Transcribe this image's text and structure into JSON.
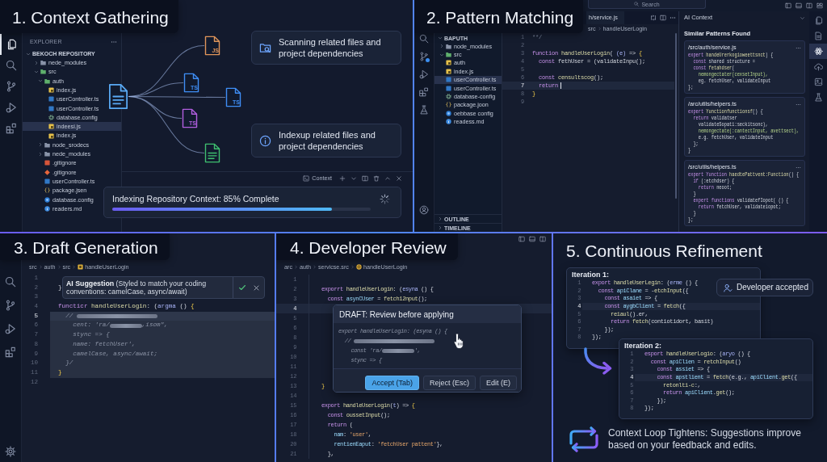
{
  "context_gathering": {
    "title": "1. Context Gathering",
    "activity_bar": [
      {
        "selected": true
      },
      {
        "selected": false
      },
      {
        "selected": false
      },
      {
        "selected": false
      },
      {
        "selected": false
      }
    ],
    "explorer": {
      "header": "EXPLORER",
      "repository": "BEKOCH REPOSITORY",
      "expanded": true,
      "tree": [
        {
          "name": "nede_modules",
          "kind": "folder",
          "expanded": false,
          "selected": false
        },
        {
          "name": "src",
          "kind": "folder",
          "expanded": true,
          "selected": false,
          "children": [
            {
              "name": "auth",
              "kind": "folder",
              "expanded": true,
              "selected": false,
              "children": [
                {
                  "name": "index.js",
                  "kind": "js",
                  "selected": false
                },
                {
                  "name": "userController.ts",
                  "kind": "ts",
                  "selected": false
                },
                {
                  "name": "userController.ts",
                  "kind": "ts",
                  "selected": false
                },
                {
                  "name": "database.config",
                  "kind": "config",
                  "selected": false
                },
                {
                  "name": "indeesi.js",
                  "kind": "js",
                  "selected": true
                },
                {
                  "name": "index.js",
                  "kind": "js",
                  "selected": false
                }
              ]
            },
            {
              "name": "node_srodecs",
              "kind": "folder",
              "expanded": false,
              "selected": false
            },
            {
              "name": "nede_modules",
              "kind": "folder",
              "expanded": false,
              "selected": false
            },
            {
              "name": ".gitignore",
              "kind": "ignore",
              "selected": false
            },
            {
              "name": ".gitignore",
              "kind": "git",
              "selected": false
            },
            {
              "name": "userController.ts",
              "kind": "ts",
              "selected": false
            },
            {
              "name": "package.jsen",
              "kind": "json",
              "selected": false
            },
            {
              "name": "database.config",
              "kind": "db",
              "selected": false
            },
            {
              "name": "readers.md",
              "kind": "markdown",
              "selected": false
            }
          ]
        }
      ]
    },
    "diagram": {
      "nodes": [
        {
          "kind": "doc",
          "color": "#5aaaf5"
        },
        {
          "kind": "code",
          "label": "JS",
          "color": "#e0955a"
        },
        {
          "kind": "code",
          "label": "TS",
          "color": "#3f8ef5"
        },
        {
          "kind": "code",
          "label": "TS",
          "color": "#3f8ef5"
        },
        {
          "kind": "code",
          "label": "TS",
          "color": "#b25fe0"
        },
        {
          "kind": "doc",
          "color": "#3fbf6f"
        }
      ]
    },
    "callouts": [
      {
        "kind": "scan",
        "text": "Scanning related files and project dependencies"
      },
      {
        "kind": "info",
        "text": "Indexup related files and project dependencies"
      }
    ],
    "terminal_tab": {
      "label": "Context"
    },
    "progress": {
      "label": "Indexing Repository Context: 85% Complete",
      "level": 0.85
    }
  },
  "pattern_matching": {
    "title": "2. Pattern Matching",
    "command_center": {
      "label": "Search"
    },
    "sidebar": {
      "header": "BAPUTH",
      "expanded": true,
      "tree": [
        {
          "name": "node_modules",
          "kind": "folder",
          "expanded": false,
          "selected": false
        },
        {
          "name": "src",
          "kind": "folder",
          "expanded": true,
          "selected": false,
          "children": [
            {
              "name": "auth",
              "kind": "js",
              "selected": false
            },
            {
              "name": "index.js",
              "kind": "js",
              "selected": false
            },
            {
              "name": "userController.ts",
              "kind": "ts",
              "selected": true
            },
            {
              "name": "userController.ts",
              "kind": "ts",
              "selected": false
            },
            {
              "name": "database-config",
              "kind": "config",
              "selected": false
            },
            {
              "name": "package.joon",
              "kind": "json",
              "selected": false
            },
            {
              "name": "oebbase config",
              "kind": "db",
              "selected": false
            },
            {
              "name": "readess.md",
              "kind": "markdown",
              "selected": false
            }
          ]
        }
      ],
      "sections": [
        {
          "label": "OUTLINE",
          "expanded": false
        },
        {
          "label": "TIMELINE",
          "expanded": false
        }
      ]
    },
    "tab": {
      "label": "h/service.js"
    },
    "breadcrumb": [
      {
        "label": "src"
      },
      {
        "label": "handleUserLogin"
      }
    ],
    "editor": {
      "cursor": true,
      "lines": [
        {
          "number": "1",
          "active": false,
          "tokens": [
            {
              "kind": "comment",
              "text": "**/"
            }
          ]
        },
        {
          "number": "2",
          "active": false
        },
        {
          "number": "3",
          "active": false,
          "tokens": [
            {
              "kind": "keyword",
              "text": "function"
            },
            {
              "kind": "function",
              "text": " handleUserLogin"
            },
            {
              "kind": "plain",
              "text": "( "
            },
            {
              "kind": "param",
              "text": "(e)"
            },
            {
              "kind": "plain",
              "text": " => "
            },
            {
              "kind": "brace",
              "text": "{"
            }
          ]
        },
        {
          "number": "4",
          "active": false,
          "tokens": [
            {
              "kind": "keyword",
              "text": "  const"
            },
            {
              "kind": "plain",
              "text": " fethUser = (validateInpu();"
            }
          ]
        },
        {
          "number": "5",
          "active": false
        },
        {
          "number": "6",
          "active": false,
          "tokens": [
            {
              "kind": "keyword",
              "text": "  const"
            },
            {
              "kind": "function",
              "text": " censultscog"
            },
            {
              "kind": "plain",
              "text": "();"
            }
          ]
        },
        {
          "number": "7",
          "active": true,
          "tokens": [
            {
              "kind": "keyword",
              "text": "  return"
            }
          ]
        },
        {
          "number": "8",
          "active": false,
          "tokens": [
            {
              "kind": "brace",
              "text": "}"
            }
          ]
        },
        {
          "number": "9",
          "active": false
        }
      ]
    },
    "ai_context": {
      "title": "AI Context",
      "heading": "Similar Patterns Found",
      "cards": [
        {
          "path": "/src/auth/service.js",
          "lines": [
            {
              "tokens": [
                {
                  "kind": "keyword",
                  "text": "expert"
                },
                {
                  "kind": "function",
                  "text": " handeUrerkogioweettsnct"
                },
                {
                  "kind": "plain",
                  "text": ") {"
                }
              ]
            },
            {
              "tokens": [
                {
                  "kind": "keyword",
                  "text": "  const"
                },
                {
                  "kind": "plain",
                  "text": " shared structure ="
                }
              ]
            },
            {
              "tokens": [
                {
                  "kind": "keyword",
                  "text": "  const"
                },
                {
                  "kind": "function",
                  "text": " fetahdser"
                },
                {
                  "kind": "plain",
                  "text": "("
                }
              ]
            },
            {
              "tokens": [
                {
                  "kind": "green",
                  "text": "    nemongectater(cexsetInput),"
                }
              ]
            },
            {
              "tokens": [
                {
                  "kind": "plain",
                  "text": "    eg. fetchUser, validateInput"
                }
              ]
            },
            {
              "tokens": [
                {
                  "kind": "plain",
                  "text": "};"
                }
              ]
            }
          ]
        },
        {
          "path": "/arc/utils/helpers.ts",
          "lines": [
            {
              "tokens": [
                {
                  "kind": "keyword",
                  "text": "expert"
                },
                {
                  "kind": "function",
                  "text": " Yunctionfunctionsf"
                },
                {
                  "kind": "plain",
                  "text": "() {"
                }
              ]
            },
            {
              "tokens": [
                {
                  "kind": "keyword",
                  "text": "  return"
                },
                {
                  "kind": "plain",
                  "text": " validatser"
                }
              ]
            },
            {
              "tokens": [
                {
                  "kind": "plain",
                  "text": "    validateSopati:seckitsonc),"
                }
              ]
            },
            {
              "tokens": [
                {
                  "kind": "green",
                  "text": "    nemongectate(:cantectInput, avettsect),"
                }
              ]
            },
            {
              "tokens": [
                {
                  "kind": "plain",
                  "text": "    e.g. fetchUser, validateInput"
                }
              ]
            },
            {
              "tokens": [
                {
                  "kind": "plain",
                  "text": "  };"
                }
              ]
            },
            {
              "tokens": [
                {
                  "kind": "plain",
                  "text": "}"
                }
              ]
            }
          ]
        },
        {
          "path": "/src/utils/helpers.ts",
          "lines": [
            {
              "tokens": [
                {
                  "kind": "keyword",
                  "text": "expert Yunction"
                },
                {
                  "kind": "function",
                  "text": " haedtePattvent:Function"
                },
                {
                  "kind": "plain",
                  "text": "() {"
                }
              ]
            },
            {
              "tokens": [
                {
                  "kind": "keyword",
                  "text": "  if"
                },
                {
                  "kind": "plain",
                  "text": " (:etchdser) {"
                }
              ]
            },
            {
              "tokens": [
                {
                  "kind": "keyword",
                  "text": "    return"
                },
                {
                  "kind": "plain",
                  "text": " neoot;"
                }
              ]
            },
            {
              "tokens": [
                {
                  "kind": "plain",
                  "text": "  }"
                }
              ]
            },
            {
              "tokens": [
                {
                  "kind": "keyword",
                  "text": "  expert functions"
                },
                {
                  "kind": "plain",
                  "text": " validatefIopot( () {"
                }
              ]
            },
            {
              "tokens": [
                {
                  "kind": "keyword",
                  "text": "    return"
                },
                {
                  "kind": "plain",
                  "text": " fetchUser, validateiopot;"
                }
              ]
            },
            {
              "tokens": [
                {
                  "kind": "plain",
                  "text": "  }"
                }
              ]
            },
            {
              "tokens": [
                {
                  "kind": "plain",
                  "text": "};"
                }
              ]
            }
          ]
        }
      ]
    },
    "right_bar": [
      {
        "selected": false
      },
      {
        "selected": false
      },
      {
        "selected": true
      },
      {
        "selected": false
      },
      {
        "selected": false
      },
      {
        "selected": false
      }
    ]
  },
  "draft_generation": {
    "title": "3. Draft Generation",
    "breadcrumb": [
      {
        "label": "src",
        "kind": "plain"
      },
      {
        "label": "auth",
        "kind": "plain"
      },
      {
        "label": "src",
        "kind": "plain"
      },
      {
        "label": "handleUserLogin",
        "kind": "symbol"
      }
    ],
    "suggestion": {
      "text": "**AI Suggestion** (Styled to match your coding conventions: camelCase, async/await)"
    },
    "editor": {
      "lines": [
        {
          "number": "1",
          "active": false
        },
        {
          "number": "2",
          "active": false,
          "tokens": [
            {
              "kind": "plain",
              "text": "}"
            }
          ]
        },
        {
          "number": "3",
          "active": false
        },
        {
          "number": "4",
          "active": false,
          "tokens": [
            {
              "kind": "keyword",
              "text": "functicr"
            },
            {
              "kind": "function",
              "text": " handleUserLogin"
            },
            {
              "kind": "plain",
              "text": ": ("
            },
            {
              "kind": "param",
              "text": "argma"
            },
            {
              "kind": "plain",
              "text": " () "
            },
            {
              "kind": "brace",
              "text": "{"
            }
          ]
        }
      ],
      "suggestion_block": {
        "lines": [
          {
            "number": "5",
            "active": true,
            "tokens": [
              {
                "kind": "ghost",
                "text": "  // "
              },
              {
                "kind": "blur"
              }
            ]
          },
          {
            "number": "6",
            "active": false,
            "tokens": [
              {
                "kind": "ghost",
                "text": "    cent: 'ra/"
              },
              {
                "kind": "smudge"
              },
              {
                "kind": "ghost",
                "text": ",isom\","
              }
            ]
          },
          {
            "number": "7",
            "active": false,
            "tokens": [
              {
                "kind": "ghost",
                "text": "    stync => {"
              }
            ]
          },
          {
            "number": "8",
            "active": false,
            "tokens": [
              {
                "kind": "ghost",
                "text": "    name: fetchUser',"
              }
            ]
          },
          {
            "number": "9",
            "active": false,
            "tokens": [
              {
                "kind": "ghost",
                "text": "    camelCase, async/await;"
              }
            ]
          },
          {
            "number": "10",
            "active": false,
            "tokens": [
              {
                "kind": "ghost",
                "text": "  }/"
              }
            ]
          },
          {
            "number": "11",
            "active": false,
            "tokens": [
              {
                "kind": "brace",
                "text": "}"
              }
            ]
          }
        ]
      },
      "lines_after": [
        {
          "number": "12",
          "active": false
        }
      ]
    }
  },
  "developer_review": {
    "title": "4. Developer Review",
    "breadcrumb": [
      {
        "label": "arc",
        "kind": "plain"
      },
      {
        "label": "auth",
        "kind": "plain"
      },
      {
        "label": "servicse.src",
        "kind": "plain"
      },
      {
        "label": "handleUserLogin",
        "kind": "method"
      }
    ],
    "editor": {
      "lines": [
        {
          "number": "1",
          "active": false
        },
        {
          "number": "2",
          "active": false,
          "tokens": [
            {
              "kind": "keyword",
              "text": "exporrt"
            },
            {
              "kind": "function",
              "text": " handleUserLogin"
            },
            {
              "kind": "plain",
              "text": ": ("
            },
            {
              "kind": "param",
              "text": "esyna"
            },
            {
              "kind": "plain",
              "text": " () {"
            }
          ]
        },
        {
          "number": "3",
          "active": false,
          "tokens": [
            {
              "kind": "keyword",
              "text": "  const"
            },
            {
              "kind": "variable",
              "text": " asynCUser"
            },
            {
              "kind": "plain",
              "text": " = "
            },
            {
              "kind": "function",
              "text": "fetch12nput"
            },
            {
              "kind": "plain",
              "text": "();"
            }
          ]
        },
        {
          "number": "4",
          "active": true
        },
        {
          "number": "5",
          "active": false
        },
        {
          "number": "6",
          "active": false
        },
        {
          "number": "8",
          "active": false
        },
        {
          "number": "9",
          "active": false
        },
        {
          "number": "10",
          "active": false
        },
        {
          "number": "11",
          "active": false
        },
        {
          "number": "12",
          "active": false
        },
        {
          "number": "13",
          "active": false,
          "tokens": [
            {
              "kind": "brace",
              "text": "}"
            }
          ]
        },
        {
          "number": "14",
          "active": false
        },
        {
          "number": "15",
          "active": false,
          "tokens": [
            {
              "kind": "keyword",
              "text": "export"
            },
            {
              "kind": "function",
              "text": " handleUserLogin"
            },
            {
              "kind": "plain",
              "text": "("
            },
            {
              "kind": "param",
              "text": "t"
            },
            {
              "kind": "plain",
              "text": ") => "
            },
            {
              "kind": "brace",
              "text": "{"
            }
          ]
        },
        {
          "number": "16",
          "active": false,
          "tokens": [
            {
              "kind": "keyword",
              "text": "  const"
            },
            {
              "kind": "function",
              "text": " oussetInput"
            },
            {
              "kind": "plain",
              "text": "();"
            }
          ]
        },
        {
          "number": "17",
          "active": false,
          "tokens": [
            {
              "kind": "keyword",
              "text": "  return"
            },
            {
              "kind": "plain",
              "text": " ("
            }
          ]
        },
        {
          "number": "18",
          "active": false,
          "tokens": [
            {
              "kind": "variable",
              "text": "    nam"
            },
            {
              "kind": "plain",
              "text": ": "
            },
            {
              "kind": "string",
              "text": "'user'"
            },
            {
              "kind": "plain",
              "text": ","
            }
          ]
        },
        {
          "number": "20",
          "active": false,
          "tokens": [
            {
              "kind": "variable",
              "text": "    rentienEaput"
            },
            {
              "kind": "plain",
              "text": ": "
            },
            {
              "kind": "string",
              "text": "'fetchUser pattent'"
            },
            {
              "kind": "plain",
              "text": "},"
            }
          ]
        },
        {
          "number": "21",
          "active": false,
          "tokens": [
            {
              "kind": "plain",
              "text": "  },"
            }
          ]
        }
      ]
    },
    "draft": {
      "title": "DRAFT: Review before applying",
      "lines": [
        {
          "tokens": [
            {
              "kind": "ghost",
              "text": "export handleUserLogin: (esyna () {"
            }
          ]
        },
        {
          "tokens": [
            {
              "kind": "ghost",
              "text": "  // "
            },
            {
              "kind": "blur"
            }
          ]
        },
        {
          "tokens": [
            {
              "kind": "ghost",
              "text": "    const 'ra/"
            },
            {
              "kind": "smudge"
            },
            {
              "kind": "ghost",
              "text": "',"
            }
          ]
        },
        {
          "tokens": [
            {
              "kind": "ghost",
              "text": "    stync => {"
            }
          ]
        }
      ],
      "buttons": [
        {
          "label": "Accept (Tab)",
          "kind": "primary"
        },
        {
          "label": "Reject (Esc)",
          "kind": "secondary"
        },
        {
          "label": "Edit (E)",
          "kind": "secondary"
        }
      ]
    }
  },
  "continuous_refinement": {
    "title": "5. Continuous Refinement",
    "iterations": [
      {
        "title": "Iteration 1:",
        "lines": [
          {
            "number": "1",
            "active": false,
            "tokens": [
              {
                "kind": "keyword",
                "text": "export"
              },
              {
                "kind": "function",
                "text": " handleUserLegin"
              },
              {
                "kind": "plain",
                "text": ": ("
              },
              {
                "kind": "param",
                "text": "erme"
              },
              {
                "kind": "plain",
                "text": " () {"
              }
            ]
          },
          {
            "number": "2",
            "active": false,
            "tokens": [
              {
                "kind": "keyword",
                "text": "  const"
              },
              {
                "kind": "variable",
                "text": " apiClane"
              },
              {
                "kind": "plain",
                "text": " = -"
              },
              {
                "kind": "function",
                "text": "etchInput"
              },
              {
                "kind": "plain",
                "text": "({"
              }
            ]
          },
          {
            "number": "3",
            "active": false,
            "tokens": [
              {
                "kind": "keyword",
                "text": "    const"
              },
              {
                "kind": "variable",
                "text": " asaiet"
              },
              {
                "kind": "plain",
                "text": " => {"
              }
            ]
          },
          {
            "number": "4",
            "active": true,
            "tokens": [
              {
                "kind": "keyword",
                "text": "    const"
              },
              {
                "kind": "variable",
                "text": " aygbClient"
              },
              {
                "kind": "plain",
                "text": " = "
              },
              {
                "kind": "function",
                "text": "fetch"
              },
              {
                "kind": "plain",
                "text": "({"
              }
            ]
          },
          {
            "number": "5",
            "active": false,
            "tokens": [
              {
                "kind": "function",
                "text": "      reiaul"
              },
              {
                "kind": "plain",
                "text": "().er,"
              }
            ]
          },
          {
            "number": "6",
            "active": false,
            "tokens": [
              {
                "kind": "keyword",
                "text": "      return"
              },
              {
                "kind": "function",
                "text": " fetch"
              },
              {
                "kind": "plain",
                "text": "(contiotidort, basit)"
              }
            ]
          },
          {
            "number": "7",
            "active": false,
            "tokens": [
              {
                "kind": "plain",
                "text": "    });"
              }
            ]
          },
          {
            "number": "8",
            "active": false,
            "tokens": [
              {
                "kind": "plain",
                "text": "});"
              }
            ]
          }
        ]
      },
      {
        "title": "Iteration 2:",
        "lines": [
          {
            "number": "1",
            "active": false,
            "tokens": [
              {
                "kind": "keyword",
                "text": "esport"
              },
              {
                "kind": "function",
                "text": " handleUserLogio"
              },
              {
                "kind": "plain",
                "text": ": ("
              },
              {
                "kind": "param",
                "text": "aryo"
              },
              {
                "kind": "plain",
                "text": " () {"
              }
            ]
          },
          {
            "number": "2",
            "active": false,
            "tokens": [
              {
                "kind": "keyword",
                "text": "  const"
              },
              {
                "kind": "variable",
                "text": " apiClien"
              },
              {
                "kind": "plain",
                "text": " = "
              },
              {
                "kind": "function",
                "text": "retchInput"
              },
              {
                "kind": "plain",
                "text": "()"
              }
            ]
          },
          {
            "number": "3",
            "active": false,
            "tokens": [
              {
                "kind": "keyword",
                "text": "    const"
              },
              {
                "kind": "variable",
                "text": " assiet"
              },
              {
                "kind": "plain",
                "text": " => {"
              }
            ]
          },
          {
            "number": "4",
            "active": true,
            "tokens": [
              {
                "kind": "keyword",
                "text": "    const"
              },
              {
                "kind": "variable",
                "text": " apstlient"
              },
              {
                "kind": "plain",
                "text": " = "
              },
              {
                "kind": "function",
                "text": "fetch"
              },
              {
                "kind": "plain",
                "text": "(e.g., "
              },
              {
                "kind": "variable",
                "text": "apiClient"
              },
              {
                "kind": "plain",
                "text": "."
              },
              {
                "kind": "function",
                "text": "get"
              },
              {
                "kind": "plain",
                "text": "({"
              }
            ]
          },
          {
            "number": "5",
            "active": false,
            "tokens": [
              {
                "kind": "function",
                "text": "      retonlti-c"
              },
              {
                "kind": "plain",
                "text": ":,"
              }
            ]
          },
          {
            "number": "6",
            "active": false,
            "tokens": [
              {
                "kind": "keyword",
                "text": "      return"
              },
              {
                "kind": "variable",
                "text": " apiClient"
              },
              {
                "kind": "plain",
                "text": "."
              },
              {
                "kind": "function",
                "text": "get"
              },
              {
                "kind": "plain",
                "text": "();"
              }
            ]
          },
          {
            "number": "7",
            "active": false,
            "tokens": [
              {
                "kind": "plain",
                "text": "    });"
              }
            ]
          },
          {
            "number": "8",
            "active": false,
            "tokens": [
              {
                "kind": "plain",
                "text": "});"
              }
            ]
          }
        ]
      }
    ],
    "status": {
      "label": "Developer accepted"
    },
    "caption": "Context Loop Tightens: Suggestions improve based on your feedback and edits."
  }
}
